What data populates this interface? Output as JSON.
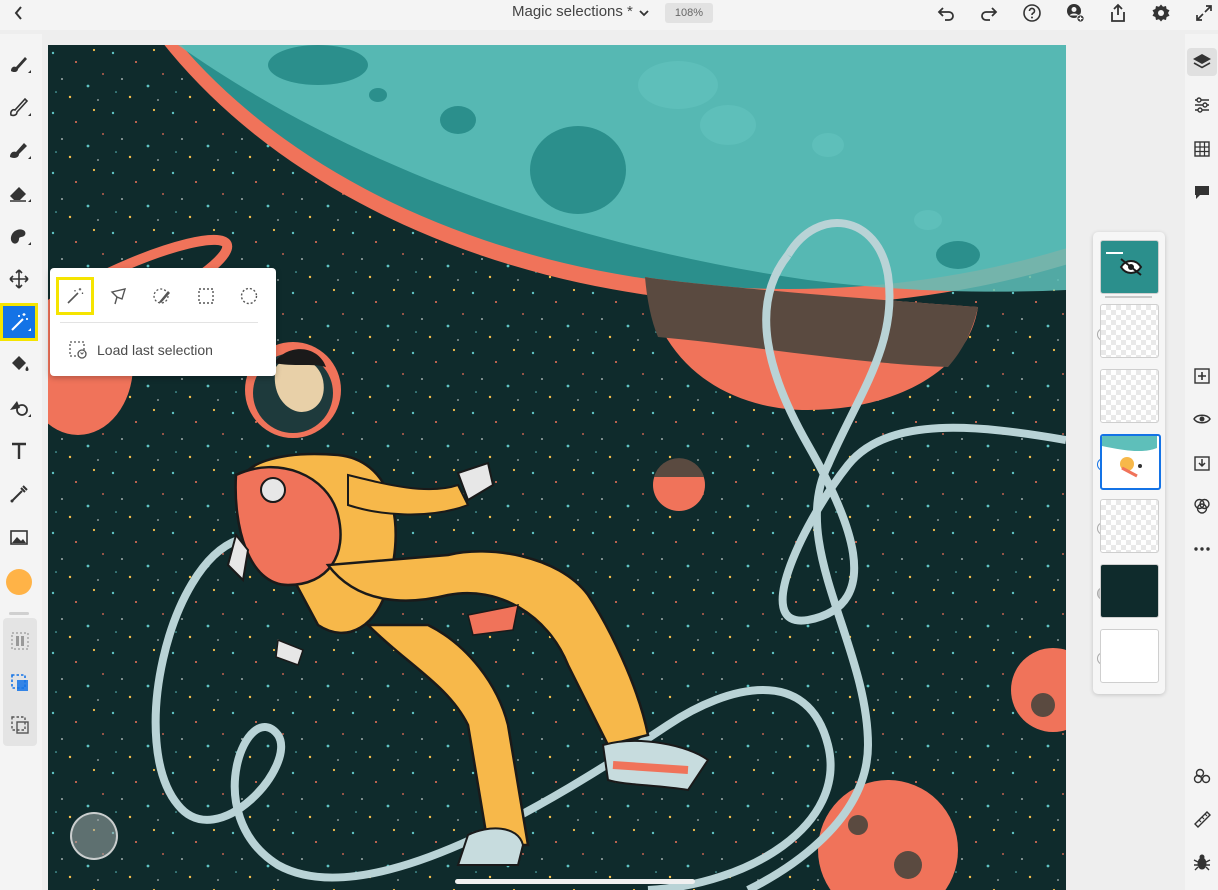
{
  "topbar": {
    "back_icon": "chevron-left-icon",
    "doc_title": "Magic selections *",
    "title_dropdown_icon": "chevron-down-icon",
    "zoom": "108%",
    "actions": [
      "undo-icon",
      "redo-icon",
      "help-icon",
      "invite-user-icon",
      "share-icon",
      "settings-icon",
      "fullscreen-icon"
    ]
  },
  "toolbar": {
    "tools": [
      "brush-icon",
      "paintbrush-icon",
      "blend-brush-icon",
      "eraser-icon",
      "healing-icon",
      "move-icon",
      "magic-wand-icon",
      "fill-icon",
      "clone-icon",
      "type-icon",
      "eyedropper-icon",
      "place-image-icon"
    ],
    "active_tool": "magic-wand-icon",
    "color_swatch": "#ffb347",
    "highlight_color": "#f5e400",
    "accent_color": "#1473e6"
  },
  "selection_popover": {
    "options": [
      "magic-wand-select-icon",
      "lasso-select-icon",
      "brush-select-icon",
      "rectangle-select-icon",
      "ellipse-select-icon"
    ],
    "load_last_selection": "Load last selection"
  },
  "right_toolbar": [
    "layers-icon",
    "adjustments-icon",
    "grid-icon",
    "comment-icon",
    "add-layer-icon",
    "visibility-icon",
    "merge-icon",
    "blend-modes-icon",
    "more-icon",
    "properties-icon",
    "measure-icon",
    "debug-icon"
  ],
  "layers_panel": {
    "thumbs": [
      "group-thumb",
      "layer-thumb-1",
      "layer-thumb-2",
      "layer-thumb-3",
      "layer-thumb-4",
      "layer-thumb-5",
      "layer-thumb-6"
    ],
    "selected_index": 3
  }
}
